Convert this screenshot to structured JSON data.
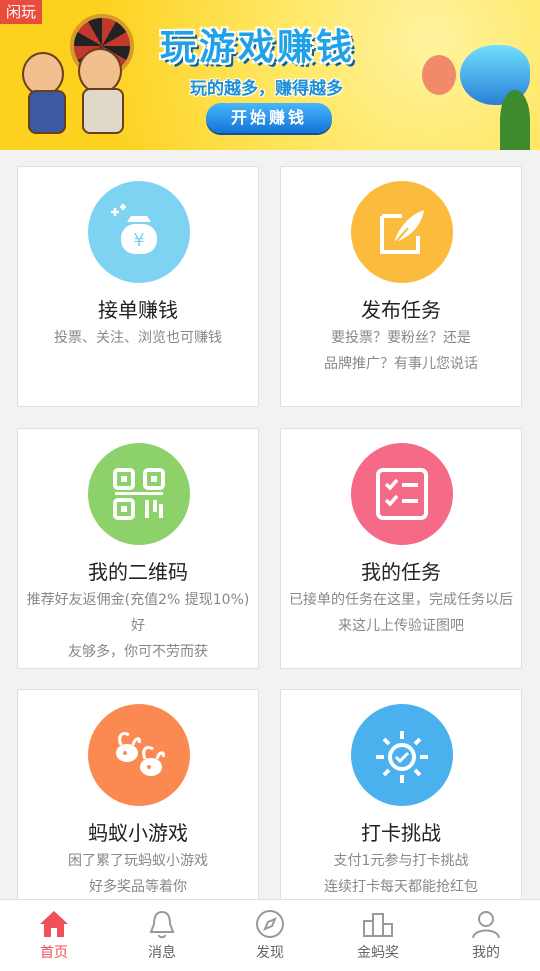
{
  "banner": {
    "tag": "闲玩",
    "title": "玩游戏赚钱",
    "subtitle": "玩的越多，赚得越多",
    "button": "开始赚钱"
  },
  "cards": [
    {
      "title": "接单赚钱",
      "desc_line1": "投票、关注、浏览也可赚钱",
      "desc_line2": "",
      "color": "#7fd3f2",
      "icon": "money-bag-icon"
    },
    {
      "title": "发布任务",
      "desc_line1": "要投票？要粉丝？还是",
      "desc_line2": "品牌推广？有事儿您说话",
      "color": "#fbbb3c",
      "icon": "feather-edit-icon"
    },
    {
      "title": "我的二维码",
      "desc_line1": "推荐好友返佣金(充值2% 提现10%)好",
      "desc_line2": "友够多，你可不劳而获",
      "color": "#8cd16a",
      "icon": "qr-code-icon"
    },
    {
      "title": "我的任务",
      "desc_line1": "已接单的任务在这里，完成任务以后",
      "desc_line2": "来这儿上传验证图吧",
      "color": "#f56a86",
      "icon": "task-list-icon"
    },
    {
      "title": "蚂蚁小游戏",
      "desc_line1": "困了累了玩蚂蚁小游戏",
      "desc_line2": "好多奖品等着你",
      "color": "#fb8a52",
      "icon": "ant-game-icon"
    },
    {
      "title": "打卡挑战",
      "desc_line1": "支付1元参与打卡挑战",
      "desc_line2": "连续打卡每天都能抢红包",
      "color": "#4bb0ee",
      "icon": "sun-checkin-icon"
    }
  ],
  "tabs": [
    {
      "label": "首页",
      "icon": "home-icon",
      "active": true
    },
    {
      "label": "消息",
      "icon": "bell-icon",
      "active": false
    },
    {
      "label": "发现",
      "icon": "compass-icon",
      "active": false
    },
    {
      "label": "金蚂奖",
      "icon": "podium-icon",
      "active": false
    },
    {
      "label": "我的",
      "icon": "user-icon",
      "active": false
    }
  ],
  "colors": {
    "accent": "#f0505a",
    "banner_bg": "#fcd21f",
    "tab_inactive": "#666666"
  }
}
